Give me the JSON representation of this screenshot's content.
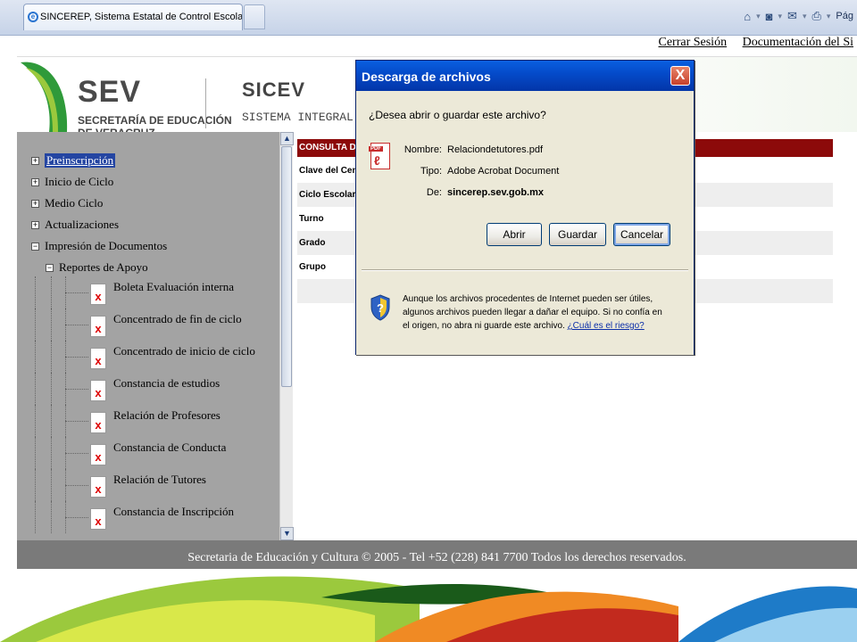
{
  "browser": {
    "tab_title": "SINCEREP, Sistema Estatal de Control Escolar",
    "toolbar_page_label": "Pág"
  },
  "top_links": {
    "logout": "Cerrar Sesión",
    "docs": "Documentación del Si"
  },
  "banner": {
    "sev": "SEV",
    "sev_line1": "SECRETARÍA DE EDUCACIÓN",
    "sev_line2": "DE VERACRUZ",
    "sicev": "SICEV",
    "sicev_sub": "SISTEMA INTEGRAL DE"
  },
  "sidebar": {
    "items": [
      {
        "label": "Preinscripción",
        "expander": "+"
      },
      {
        "label": "Inicio de Ciclo",
        "expander": "+"
      },
      {
        "label": "Medio Ciclo",
        "expander": "+"
      },
      {
        "label": "Actualizaciones",
        "expander": "+"
      },
      {
        "label": "Impresión de Documentos",
        "expander": "−"
      }
    ],
    "subgroup": {
      "label": "Reportes de Apoyo",
      "expander": "−"
    },
    "reports": [
      {
        "label": "Boleta Evaluación interna"
      },
      {
        "label": "Concentrado de fin de ciclo"
      },
      {
        "label": "Concentrado de inicio de ciclo"
      },
      {
        "label": "Constancia de estudios"
      },
      {
        "label": "Relación de Profesores"
      },
      {
        "label": "Constancia de Conducta"
      },
      {
        "label": "Relación de Tutores"
      },
      {
        "label": "Constancia de Inscripción"
      }
    ]
  },
  "form": {
    "header": "CONSULTA DE T",
    "rows": [
      "Clave del Centr",
      "Ciclo Escolar",
      "Turno",
      "Grado",
      "Grupo"
    ]
  },
  "footer": {
    "text": "Secretaria de Educación y Cultura © 2005 - Tel +52 (228) 841 7700 Todos los derechos reservados."
  },
  "dialog": {
    "title": "Descarga de archivos",
    "close": "X",
    "question": "¿Desea abrir o guardar este archivo?",
    "name_label": "Nombre:",
    "name_value": "Relaciondetutores.pdf",
    "type_label": "Tipo:",
    "type_value": "Adobe Acrobat Document",
    "from_label": "De:",
    "from_value": "sincerep.sev.gob.mx",
    "btn_open": "Abrir",
    "btn_save": "Guardar",
    "btn_cancel": "Cancelar",
    "warning_line1": "Aunque los archivos procedentes de Internet pueden ser útiles,",
    "warning_line2": "algunos archivos pueden llegar a dañar el equipo. Si no confía en",
    "warning_line3": "el origen, no abra ni guarde este archivo.",
    "risk_link": "¿Cuál es el riesgo?",
    "pdf_icon_text": "PDF"
  },
  "colors": {
    "dialog_title": "#0449c8",
    "form_header": "#8c0a0a",
    "sidebar_bg": "#a3a3a3",
    "footer_bg": "#7a7a7a",
    "selected_item": "#2445a2"
  },
  "icons": [
    "ie-logo-icon",
    "home-icon",
    "feeds-icon",
    "mail-icon",
    "print-icon",
    "pdf-file-icon",
    "shield-question-icon",
    "close-icon",
    "broken-image-icon",
    "scroll-up-icon",
    "scroll-down-icon"
  ]
}
